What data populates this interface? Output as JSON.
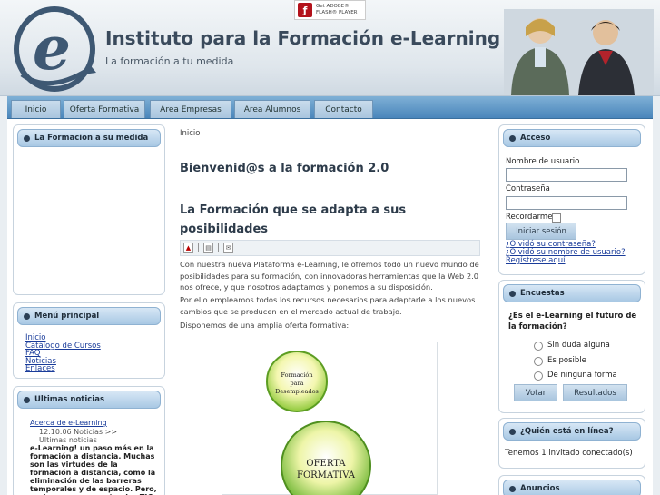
{
  "header": {
    "title": "Instituto para la Formación e-Learning",
    "slogan": "La formación a tu medida",
    "flash_badge": {
      "line1": "Get ADOBE®",
      "line2": "FLASH® PLAYER"
    }
  },
  "nav": {
    "items": [
      {
        "label": "Inicio"
      },
      {
        "label": "Oferta Formativa"
      },
      {
        "label": "Area Empresas"
      },
      {
        "label": "Area Alumnos"
      },
      {
        "label": "Contacto"
      }
    ]
  },
  "left": {
    "formacion": {
      "title": "La Formacion a su medida"
    },
    "menu": {
      "title": "Menú principal",
      "items": [
        "Inicio",
        "Catálogo de Cursos",
        "FAQ",
        "Noticias",
        "Enlaces"
      ]
    },
    "news": {
      "title": "Ultimas noticias",
      "item_link": "Acerca de e-Learning",
      "item_meta": "12.10.06 Noticias >> Ultimas noticias",
      "item_excerpt": "e-Learning! un paso más en la formación a distancia. Muchas son las virtudes de la formación a distancia, como la eliminación de las barreras temporales y de espacio. Pero, ¿sabemos que aportan las TIC a nuestra"
    }
  },
  "main": {
    "breadcrumb": "Inicio",
    "welcome": "Bienvenid@s a la formación 2.0",
    "article_title": "La Formación que se adapta a sus posibilidades",
    "paragraph1": "Con nuestra nueva Plataforma e-Learning, le ofremos todo un nuevo mundo de posibilidades para su formación, con innovadoras herramientas que la Web 2.0 nos ofrece, y que nosotros adaptamos y ponemos a su disposición.",
    "paragraph2": "Por ello empleamos todos los recursos necesarios para adaptarle a los nuevos cambios que se producen en el mercado actual de trabajo.",
    "paragraph3": "Disponemos de una amplia oferta formativa:",
    "graphic": {
      "small_circle": [
        "Formación",
        "para",
        "Desempleados"
      ],
      "big_circle": [
        "OFERTA",
        "FORMATIVA"
      ]
    }
  },
  "right": {
    "login": {
      "title": "Acceso",
      "username_label": "Nombre de usuario",
      "password_label": "Contraseña",
      "remember_label": "Recordarme",
      "submit_label": "Iniciar sesión",
      "forgot_password": "¿Olvidó su contraseña?",
      "forgot_username": "¿Olvidó su nombre de usuario?",
      "register": "Regístrese aquí"
    },
    "poll": {
      "title": "Encuestas",
      "question": "¿Es el e-Learning el futuro de la formación?",
      "options": [
        "Sin duda alguna",
        "Es posible",
        "De ninguna forma"
      ],
      "vote_label": "Votar",
      "results_label": "Resultados"
    },
    "online": {
      "title": "¿Quién está en línea?",
      "text": "Tenemos 1 invitado conectado(s)"
    },
    "ads": {
      "title": "Anuncios"
    }
  }
}
